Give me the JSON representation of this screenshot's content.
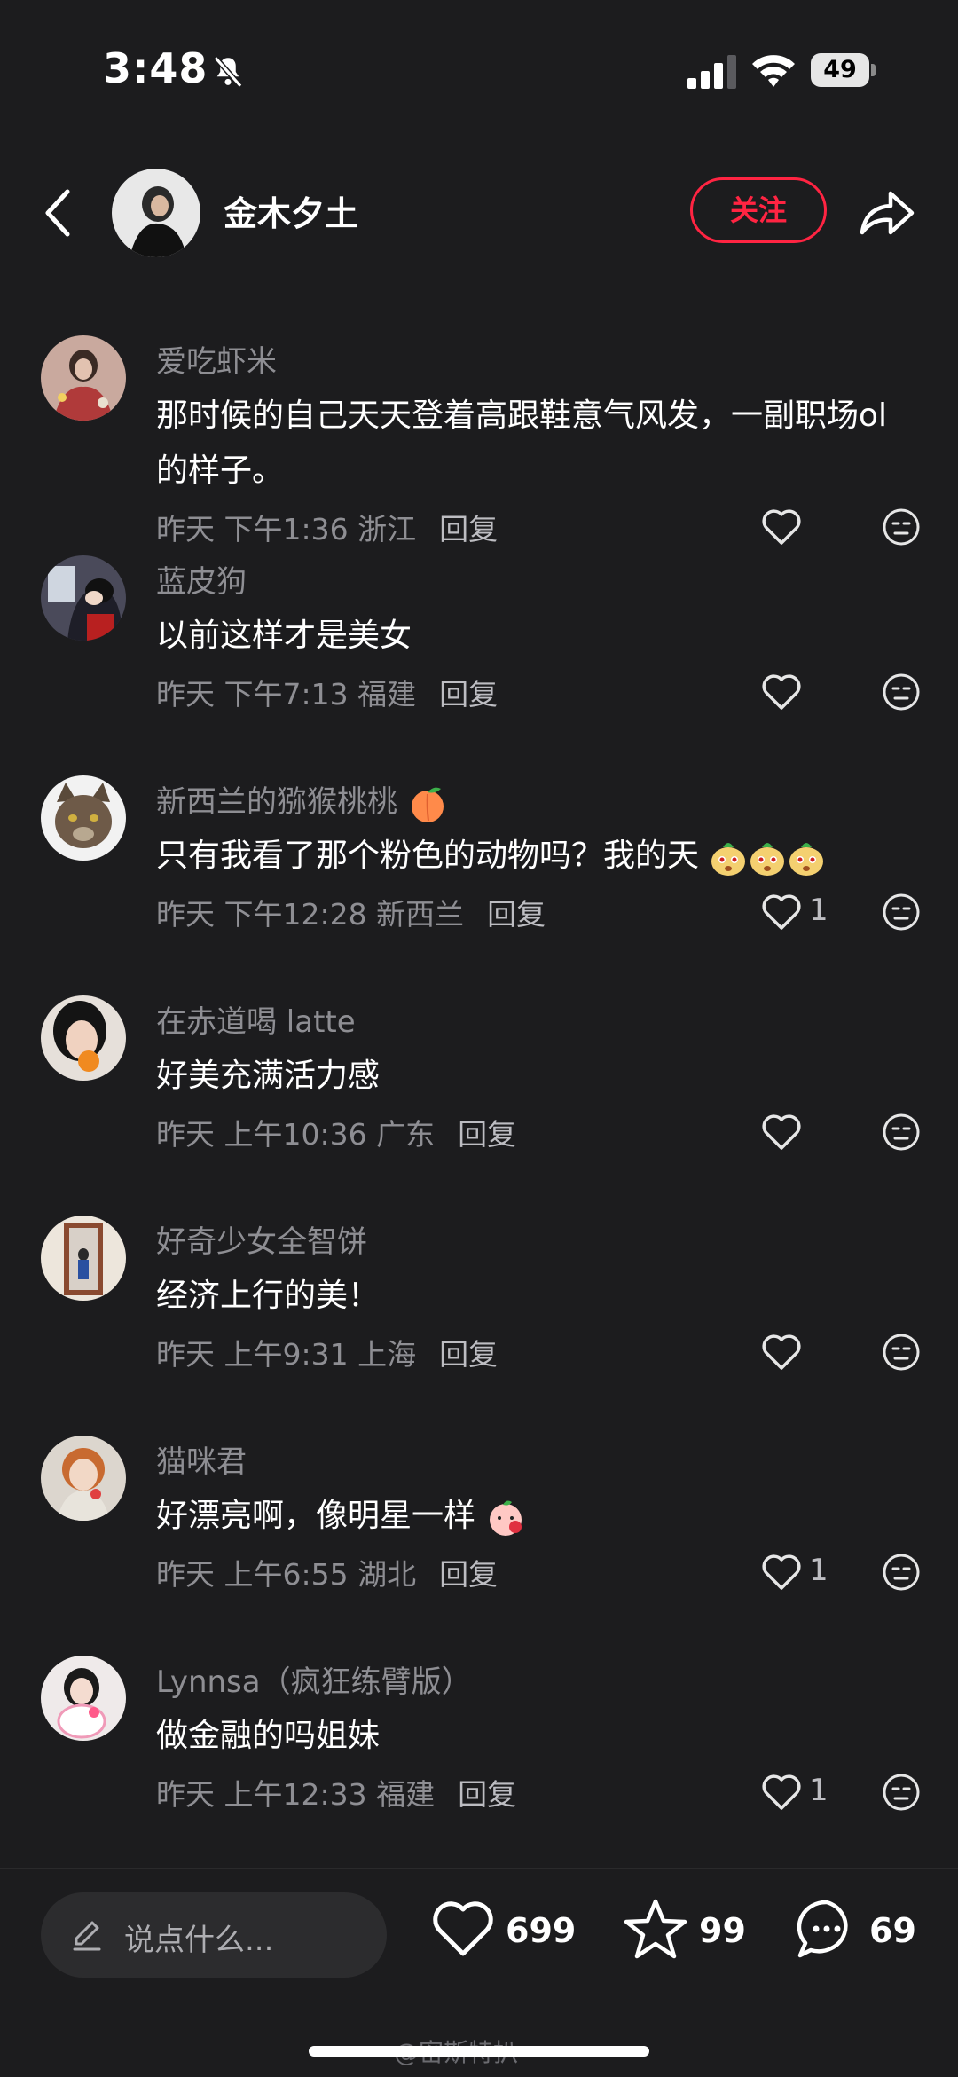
{
  "status": {
    "time": "3:48",
    "battery": "49"
  },
  "header": {
    "author": "金木夕土",
    "follow_label": "关注"
  },
  "comments": [
    {
      "name": "爱吃虾米",
      "text": "那时候的自己天天登着高跟鞋意气风发，一副职场ol 的样子。",
      "time": "昨天 下午1:36 浙江",
      "reply": "回复",
      "likes": ""
    },
    {
      "name": "蓝皮狗",
      "text": "以前这样才是美女",
      "time": "昨天 下午7:13 福建",
      "reply": "回复",
      "likes": ""
    },
    {
      "name": "新西兰的猕猴桃桃",
      "text": "只有我看了那个粉色的动物吗？我的天",
      "time": "昨天 下午12:28 新西兰",
      "reply": "回复",
      "likes": "1"
    },
    {
      "name": "在赤道喝 latte",
      "text": "好美充满活力感",
      "time": "昨天 上午10:36 广东",
      "reply": "回复",
      "likes": ""
    },
    {
      "name": "好奇少女全智饼",
      "text": "经济上行的美！",
      "time": "昨天 上午9:31 上海",
      "reply": "回复",
      "likes": ""
    },
    {
      "name": "猫咪君",
      "text": "好漂亮啊，像明星一样",
      "time": "昨天 上午6:55 湖北",
      "reply": "回复",
      "likes": "1"
    },
    {
      "name": "Lynnsa（疯狂练臂版）",
      "text": "做金融的吗姐妹",
      "time": "昨天 上午12:33 福建",
      "reply": "回复",
      "likes": "1"
    }
  ],
  "bottom": {
    "placeholder": "说点什么...",
    "likes": "699",
    "favorites": "99",
    "comments": "69"
  },
  "watermark": "@密斯特扒",
  "colors": {
    "accent": "#ff2442",
    "background": "#1c1c1e",
    "secondary_text": "#8e8e93"
  }
}
